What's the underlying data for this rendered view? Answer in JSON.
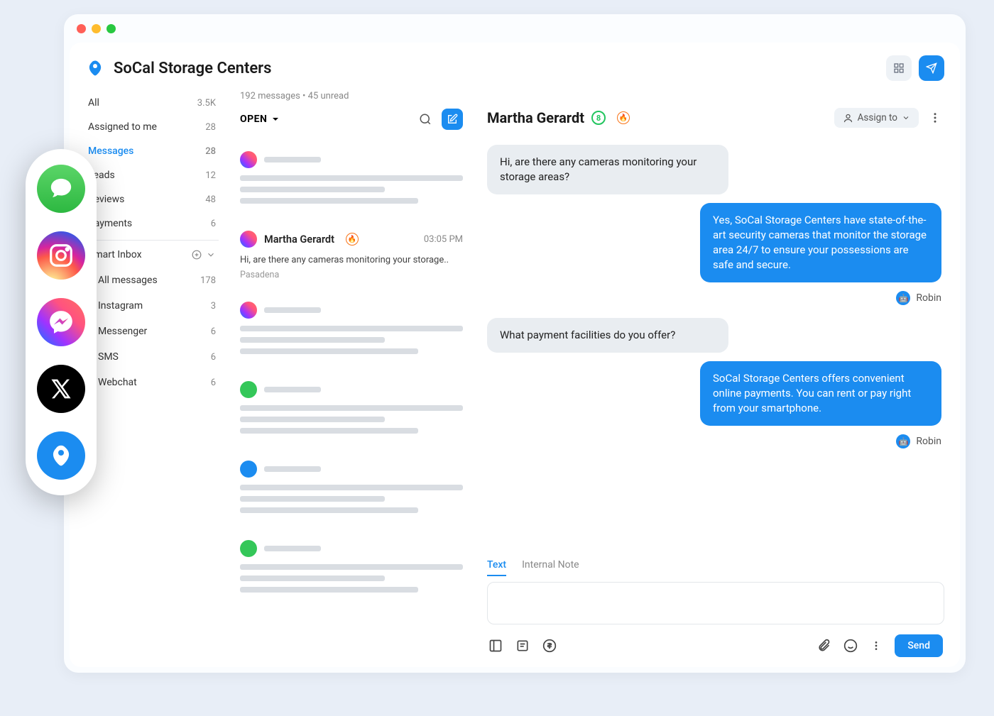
{
  "app": {
    "title": "SoCal Storage Centers"
  },
  "sidebar": {
    "items": [
      {
        "label": "All",
        "count": "3.5K"
      },
      {
        "label": "Assigned to me",
        "count": "28"
      },
      {
        "label": "Messages",
        "count": "28"
      },
      {
        "label": "Leads",
        "count": "12"
      },
      {
        "label": "Reviews",
        "count": "48"
      },
      {
        "label": "Payments",
        "count": "6"
      }
    ],
    "group_label": "Smart Inbox",
    "channels": [
      {
        "label": "All messages",
        "count": "178",
        "color": "#1b8cf0"
      },
      {
        "label": "Instagram",
        "count": "3",
        "color": "#e1306c"
      },
      {
        "label": "Messenger",
        "count": "6",
        "color": "#a033ff"
      },
      {
        "label": "SMS",
        "count": "6",
        "color": "#34c759"
      },
      {
        "label": "Webchat",
        "count": "6",
        "color": "#1b8cf0"
      }
    ]
  },
  "list": {
    "meta": "192 messages • 45 unread",
    "status_label": "OPEN",
    "conversations": [
      {
        "type": "skeleton",
        "channel": "messenger"
      },
      {
        "type": "real",
        "channel": "messenger",
        "name": "Martha Gerardt",
        "time": "03:05 PM",
        "preview": "Hi, are there any cameras monitoring your storage..",
        "location": "Pasadena"
      },
      {
        "type": "skeleton",
        "channel": "messenger"
      },
      {
        "type": "skeleton",
        "channel": "sms"
      },
      {
        "type": "skeleton",
        "channel": "bird"
      },
      {
        "type": "skeleton",
        "channel": "sms"
      }
    ]
  },
  "chat": {
    "name": "Martha Gerardt",
    "badge_value": "8",
    "assign_label": "Assign to",
    "messages": [
      {
        "dir": "in",
        "text": "Hi, are there any cameras monitoring your storage areas?"
      },
      {
        "dir": "out",
        "text": "Yes, SoCal Storage Centers have state-of-the-art security cameras that monitor the storage area 24/7 to ensure your possessions are safe and secure.",
        "agent": "Robin"
      },
      {
        "dir": "in",
        "text": "What payment facilities do you offer?"
      },
      {
        "dir": "out",
        "text": "SoCal Storage Centers offers convenient online payments. You can rent or pay right from your smartphone.",
        "agent": "Robin"
      }
    ],
    "compose": {
      "tabs": [
        {
          "label": "Text"
        },
        {
          "label": "Internal Note"
        }
      ],
      "send_label": "Send"
    }
  }
}
